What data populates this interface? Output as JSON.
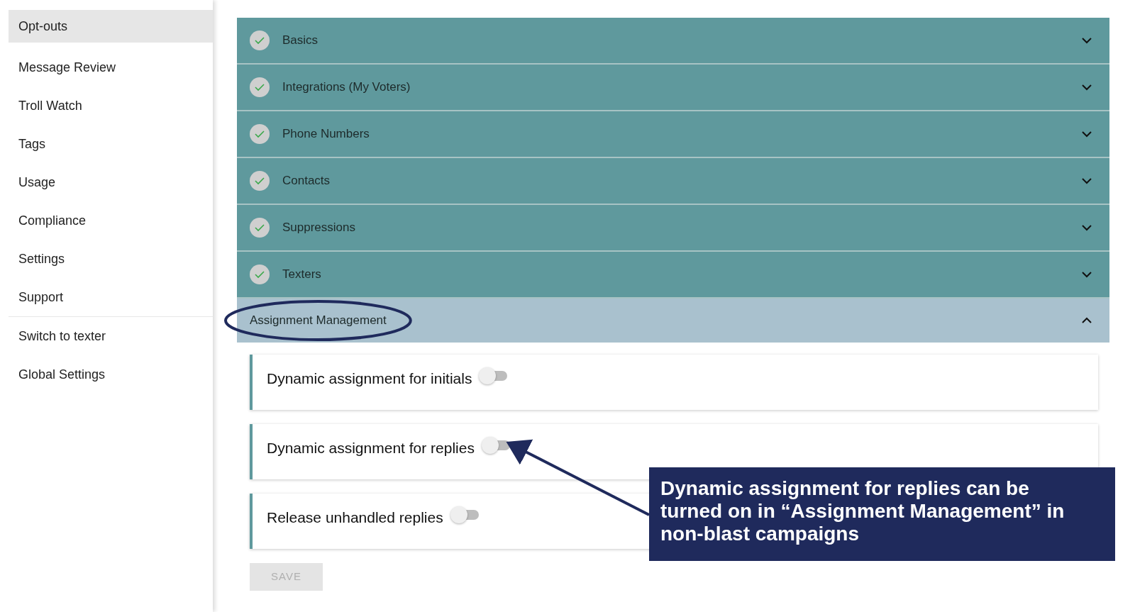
{
  "sidebar": {
    "items": [
      {
        "label": "Opt-outs",
        "selected": true
      },
      {
        "label": "Message Review",
        "selected": false
      },
      {
        "label": "Troll Watch",
        "selected": false
      },
      {
        "label": "Tags",
        "selected": false
      },
      {
        "label": "Usage",
        "selected": false
      },
      {
        "label": "Compliance",
        "selected": false
      },
      {
        "label": "Settings",
        "selected": false
      },
      {
        "label": "Support",
        "selected": false
      },
      {
        "label": "Switch to texter",
        "selected": false,
        "divider_before": true
      },
      {
        "label": "Global Settings",
        "selected": false
      }
    ]
  },
  "sections": [
    {
      "title": "Basics",
      "completed": true,
      "expanded": false
    },
    {
      "title": "Integrations (My Voters)",
      "completed": true,
      "expanded": false
    },
    {
      "title": "Phone Numbers",
      "completed": true,
      "expanded": false
    },
    {
      "title": "Contacts",
      "completed": true,
      "expanded": false
    },
    {
      "title": "Suppressions",
      "completed": true,
      "expanded": false
    },
    {
      "title": "Texters",
      "completed": true,
      "expanded": false
    },
    {
      "title": "Assignment Management",
      "completed": false,
      "expanded": true,
      "settings": [
        {
          "label": "Dynamic assignment for initials",
          "on": false
        },
        {
          "label": "Dynamic assignment for replies",
          "on": false
        },
        {
          "label": "Release unhandled replies",
          "on": false
        }
      ],
      "save_button": {
        "label": "SAVE",
        "disabled": true
      }
    }
  ],
  "annotation": {
    "text": "Dynamic assignment for replies can be turned on in “Assignment Management” in non-blast campaigns"
  }
}
